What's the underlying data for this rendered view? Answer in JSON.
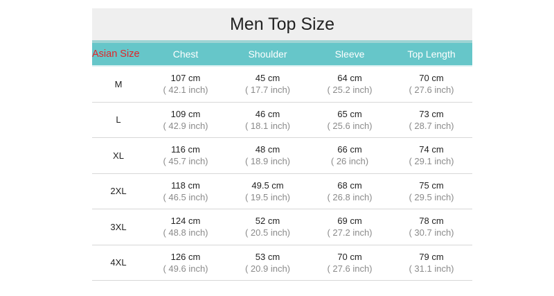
{
  "title": "Men Top Size",
  "header": [
    "Asian Size",
    "Chest",
    "Shoulder",
    "Sleeve",
    "Top Length"
  ],
  "rows": [
    {
      "size": "M",
      "cells": [
        [
          "107 cm",
          "( 42.1 inch)"
        ],
        [
          "45 cm",
          "( 17.7 inch)"
        ],
        [
          "64 cm",
          "( 25.2 inch)"
        ],
        [
          "70 cm",
          "( 27.6 inch)"
        ]
      ]
    },
    {
      "size": "L",
      "cells": [
        [
          "109 cm",
          "( 42.9 inch)"
        ],
        [
          "46 cm",
          "( 18.1 inch)"
        ],
        [
          "65 cm",
          "( 25.6 inch)"
        ],
        [
          "73 cm",
          "( 28.7 inch)"
        ]
      ]
    },
    {
      "size": "XL",
      "cells": [
        [
          "116 cm",
          "( 45.7 inch)"
        ],
        [
          "48 cm",
          "( 18.9 inch)"
        ],
        [
          "66 cm",
          "( 26 inch)"
        ],
        [
          "74 cm",
          "( 29.1 inch)"
        ]
      ]
    },
    {
      "size": "2XL",
      "cells": [
        [
          "118 cm",
          "( 46.5 inch)"
        ],
        [
          "49.5 cm",
          "( 19.5 inch)"
        ],
        [
          "68 cm",
          "( 26.8 inch)"
        ],
        [
          "75 cm",
          "( 29.5 inch)"
        ]
      ]
    },
    {
      "size": "3XL",
      "cells": [
        [
          "124 cm",
          "( 48.8 inch)"
        ],
        [
          "52 cm",
          "( 20.5 inch)"
        ],
        [
          "69 cm",
          "( 27.2 inch)"
        ],
        [
          "78 cm",
          "( 30.7 inch)"
        ]
      ]
    },
    {
      "size": "4XL",
      "cells": [
        [
          "126 cm",
          "( 49.6 inch)"
        ],
        [
          "53 cm",
          "( 20.9 inch)"
        ],
        [
          "70 cm",
          "( 27.6 inch)"
        ],
        [
          "79 cm",
          "( 31.1 inch)"
        ]
      ]
    }
  ]
}
